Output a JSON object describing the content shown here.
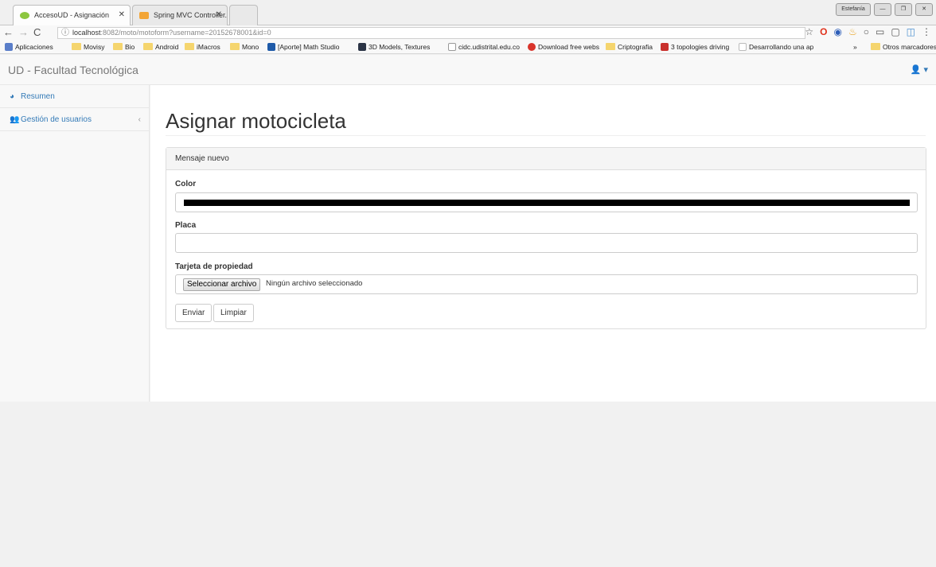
{
  "browser": {
    "tabs": [
      {
        "title": "AccesoUD - Asignación",
        "close": "✕"
      },
      {
        "title": "Spring MVC Controller. H",
        "close": "✕"
      }
    ],
    "window_controls": [
      "Estefanía",
      "—",
      "❐",
      "✕"
    ],
    "address": {
      "host": "localhost",
      "rest": ":8082/moto/motoform?username=20152678001&id=0"
    },
    "bookmarks": [
      {
        "label": "Aplicaciones",
        "icon": "apps-icon"
      },
      {
        "label": "Movisy",
        "icon": "folder-icon"
      },
      {
        "label": "Bio",
        "icon": "folder-icon"
      },
      {
        "label": "Android",
        "icon": "folder-icon"
      },
      {
        "label": "iMacros",
        "icon": "folder-icon"
      },
      {
        "label": "Mono",
        "icon": "folder-icon"
      },
      {
        "label": "[Aporte] Math Studio",
        "icon": "taringa-icon"
      },
      {
        "label": "3D Models, Textures",
        "icon": "site-icon"
      },
      {
        "label": "cidc.udistrital.edu.co",
        "icon": "page-icon"
      },
      {
        "label": "Download free webs",
        "icon": "site-icon"
      },
      {
        "label": "Criptografia",
        "icon": "folder-icon"
      },
      {
        "label": "3 topologies driving",
        "icon": "site-icon"
      },
      {
        "label": "Desarrollando una ap",
        "icon": "site-icon"
      },
      {
        "label": "»",
        "icon": ""
      },
      {
        "label": "Otros marcadores",
        "icon": "folder-icon"
      }
    ]
  },
  "app": {
    "brand": "UD - Facultad Tecnológica",
    "user_menu": "▾"
  },
  "sidebar": {
    "items": [
      {
        "label": "Resumen",
        "icon": "dashboard-icon"
      },
      {
        "label": "Gestión de usuarios",
        "icon": "users-icon",
        "chevron": "‹"
      }
    ]
  },
  "main": {
    "title": "Asignar motocicleta",
    "panel_heading": "Mensaje nuevo",
    "fields": {
      "color_label": "Color",
      "color_value_hex": "#000000",
      "placa_label": "Placa",
      "placa_value": "",
      "tarjeta_label": "Tarjeta de propiedad",
      "file_button": "Seleccionar archivo",
      "file_status": "Ningún archivo seleccionado"
    },
    "buttons": {
      "submit": "Enviar",
      "reset": "Limpiar"
    }
  }
}
